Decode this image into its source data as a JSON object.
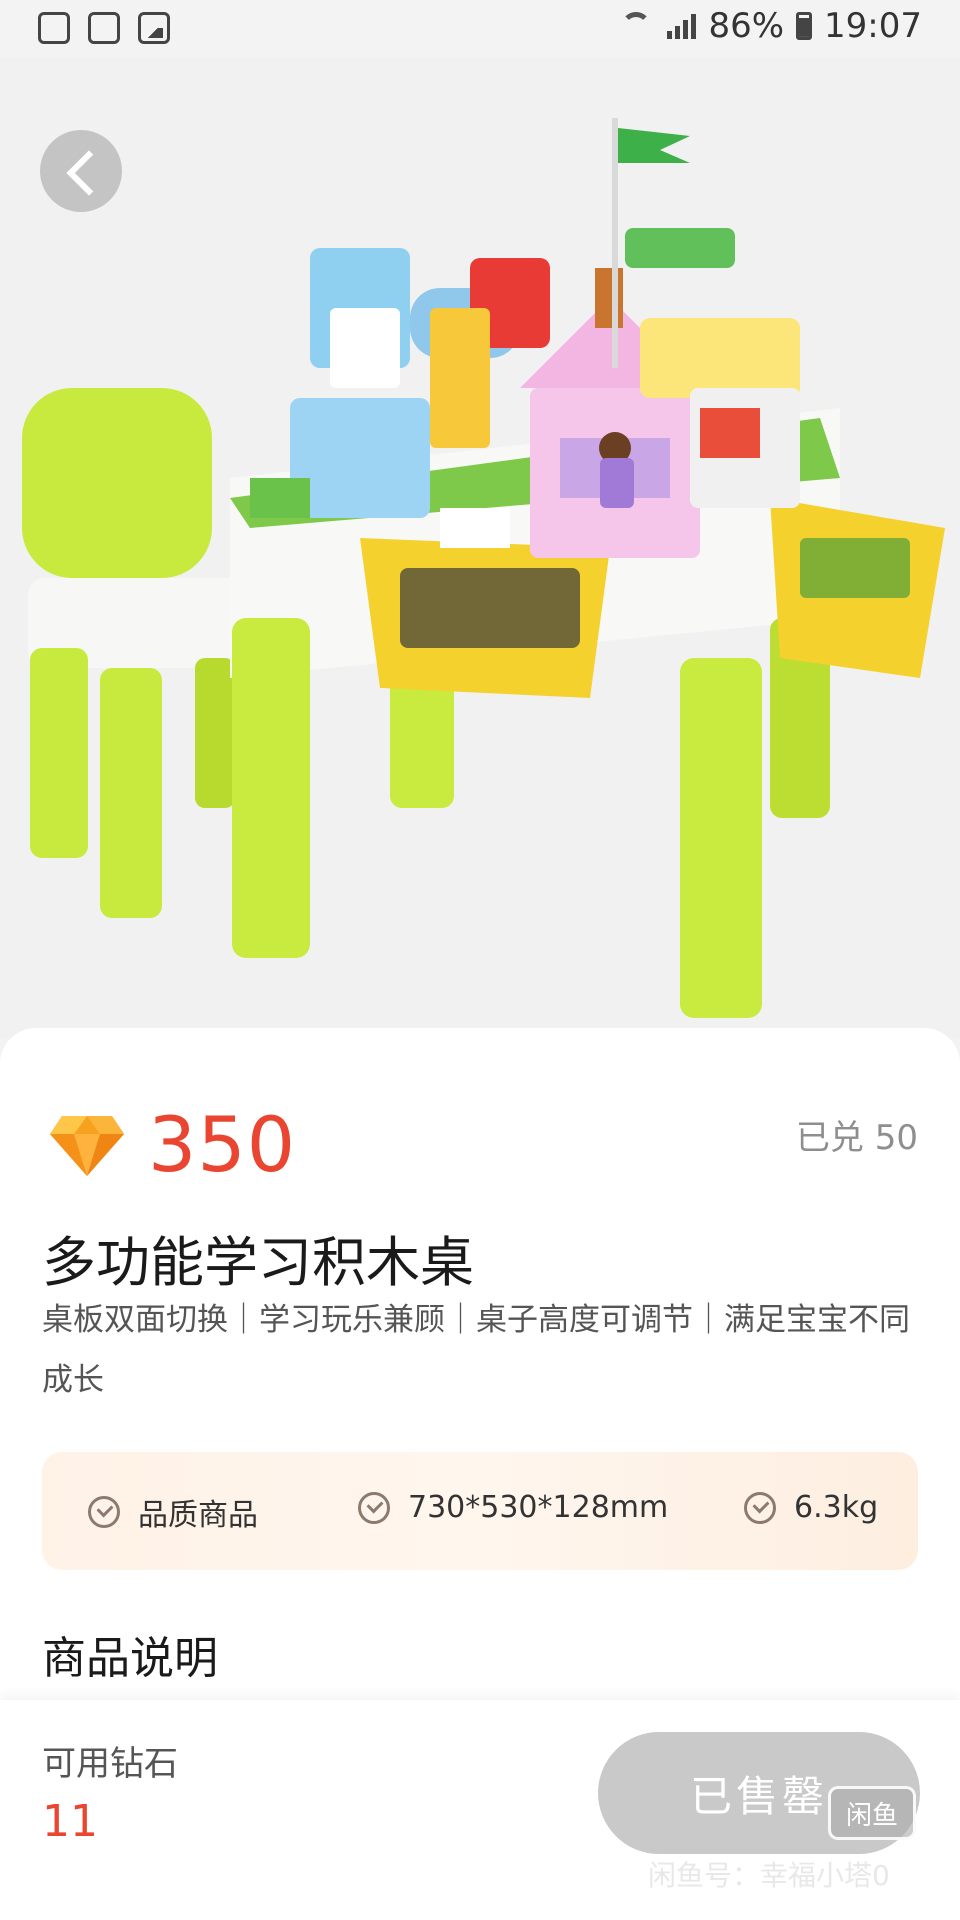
{
  "status_bar": {
    "battery": "86%",
    "time": "19:07"
  },
  "product": {
    "price": "350",
    "redeemed": "已兑 50",
    "title": "多功能学习积木桌",
    "subtitle": "桌板双面切换｜学习玩乐兼顾｜桌子高度可调节｜满足宝宝不同成长",
    "tags": [
      "品质商品",
      "730*530*128mm",
      "6.3kg"
    ],
    "section_title": "商品说明"
  },
  "bottom_bar": {
    "available_label": "可用钻石",
    "available_value": "11",
    "sold_out_label": "已售罄",
    "badge": "闲鱼",
    "watermark": "闲鱼号：幸福小塔0"
  },
  "colors": {
    "price_red": "#e94531",
    "gem_orange": "#f59a1e",
    "table_green": "#c7ea3c",
    "bin_yellow": "#f4cf2a"
  }
}
